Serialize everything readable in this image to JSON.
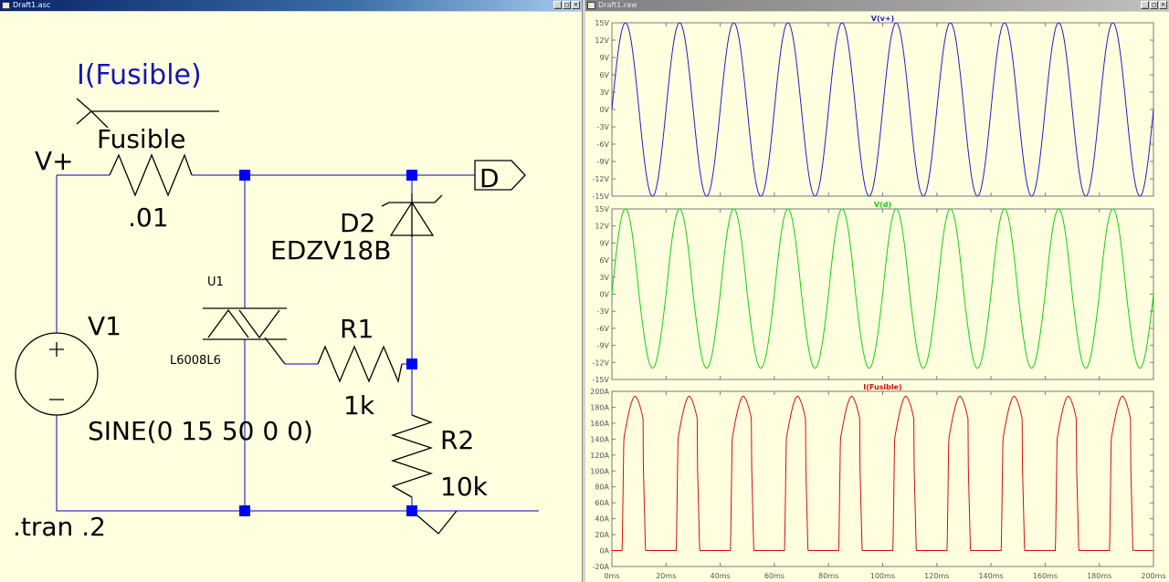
{
  "left_window": {
    "title": "Draft1.asc"
  },
  "right_window": {
    "title": "Draft1.raw"
  },
  "window_buttons": {
    "minimize": "_",
    "maximize": "□",
    "close": "×"
  },
  "schematic": {
    "probe_label": "I(Fusible)",
    "fuse_name": "Fusible",
    "fuse_value": ".01",
    "node_vplus": "V+",
    "flag_d": "D",
    "diode_name": "D2",
    "diode_model": "EDZV18B",
    "triac_name": "U1",
    "triac_model": "L6008L6",
    "r1_name": "R1",
    "r1_value": "1k",
    "r2_name": "R2",
    "r2_value": "10k",
    "source_name": "V1",
    "source_value": "SINE(0 15 50 0 0)",
    "directive": ".tran .2",
    "colors": {
      "wire": "#0000cc",
      "junction": "#0000ff",
      "text": "#000000",
      "probe": "#1414b4",
      "background": "#ffffe0"
    }
  },
  "x_axis": {
    "ticks": [
      "0ms",
      "20ms",
      "40ms",
      "60ms",
      "80ms",
      "100ms",
      "120ms",
      "140ms",
      "160ms",
      "180ms",
      "200ms"
    ]
  },
  "chart_data": [
    {
      "type": "line",
      "title": "V(v+)",
      "color": "#2020c8",
      "x_range_ms": [
        0,
        200
      ],
      "ylim": [
        -15,
        15
      ],
      "y_ticks": [
        "15V",
        "12V",
        "9V",
        "6V",
        "3V",
        "0V",
        "-3V",
        "-6V",
        "-9V",
        "-12V",
        "-15V"
      ],
      "waveform": {
        "shape": "sine",
        "amplitude": 15,
        "frequency_hz": 50
      }
    },
    {
      "type": "line",
      "title": "V(d)",
      "color": "#10d010",
      "x_range_ms": [
        0,
        200
      ],
      "ylim": [
        -15,
        15
      ],
      "y_ticks": [
        "15V",
        "12V",
        "9V",
        "6V",
        "3V",
        "0V",
        "-3V",
        "-6V",
        "-9V",
        "-12V",
        "-15V"
      ],
      "waveform": {
        "shape": "sine",
        "positive_peak": 15,
        "negative_peak": -13,
        "frequency_hz": 50
      }
    },
    {
      "type": "line",
      "title": "I(Fusible)",
      "color": "#d01010",
      "x_range_ms": [
        0,
        200
      ],
      "ylim": [
        -20,
        200
      ],
      "y_ticks": [
        "200A",
        "180A",
        "160A",
        "140A",
        "120A",
        "100A",
        "80A",
        "60A",
        "40A",
        "20A",
        "0A",
        "-20A"
      ],
      "waveform": {
        "shape": "half-wave pulses",
        "peak": 195,
        "frequency_hz": 50
      }
    }
  ]
}
